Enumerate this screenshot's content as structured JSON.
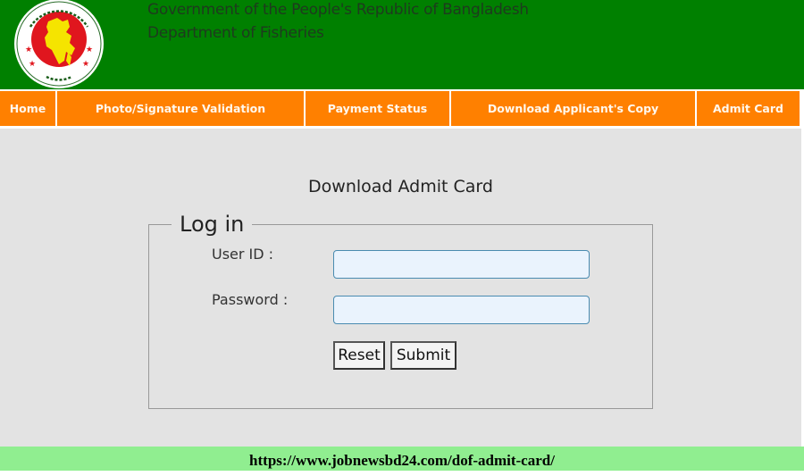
{
  "header": {
    "line1": "Government of the People's Republic of Bangladesh",
    "line2": "Department of Fisheries",
    "logo_icon": "bangladesh-government-seal-icon",
    "colors": {
      "background": "#008000",
      "seal_red": "#e0161e",
      "map_yellow": "#f5e400"
    }
  },
  "nav": {
    "items": [
      {
        "label": "Home"
      },
      {
        "label": "Photo/Signature Validation"
      },
      {
        "label": "Payment Status"
      },
      {
        "label": "Download Applicant's Copy"
      },
      {
        "label": "Admit Card"
      }
    ],
    "color": "#ff8000"
  },
  "main": {
    "title": "Download Admit Card",
    "form": {
      "legend": "Log in",
      "user_id_label": "User ID :",
      "user_id_value": "",
      "password_label": "Password :",
      "password_value": "",
      "reset_label": "Reset",
      "submit_label": "Submit"
    }
  },
  "footer": {
    "url_text": "https://www.jobnewsbd24.com/dof-admit-card/",
    "color": "#90ee90"
  }
}
